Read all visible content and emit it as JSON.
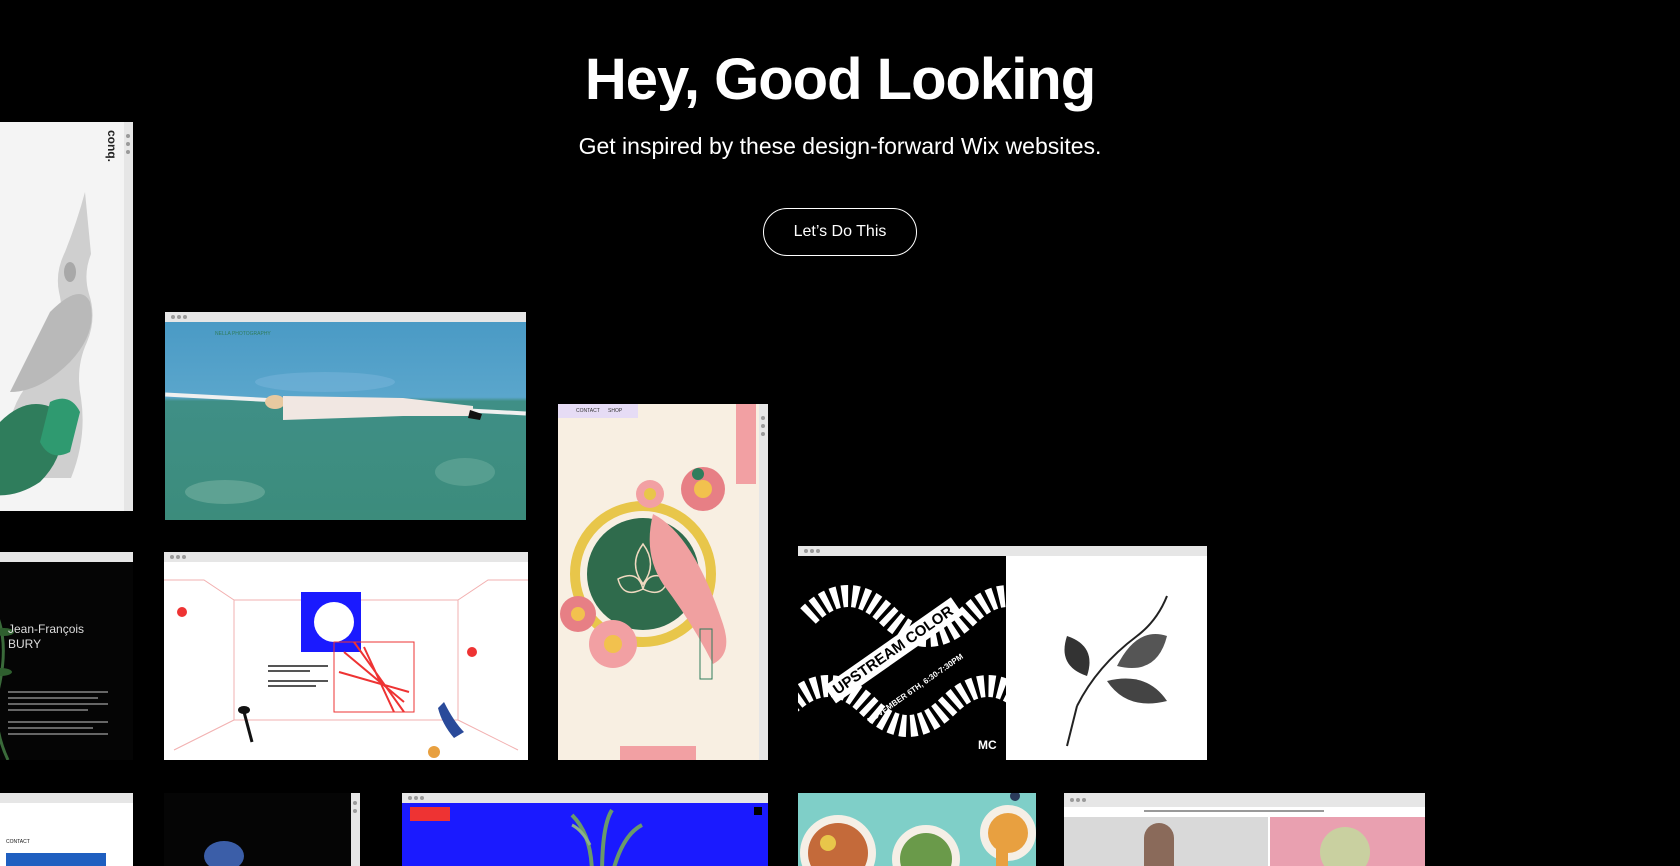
{
  "hero": {
    "title": "Hey, Good Looking",
    "subtitle": "Get inspired by these design-forward Wix websites.",
    "cta_label": "Let’s Do This"
  },
  "cards": {
    "conq": {
      "logo": "conq."
    },
    "photo": {
      "brand": "NELLA PHOTOGRAPHY"
    },
    "jean": {
      "name_line1": "Jean-François",
      "name_line2": "BURY"
    },
    "poster": {
      "headline": "UPSTREAM COLOR",
      "date_line": "NOVEMBER 6TH, 6:30-7:30PM",
      "mc": "MC"
    },
    "pink": {
      "tab1": "CONTACT",
      "tab2": "SHOP"
    },
    "bottom_left": {
      "menu_item": "CONTACT"
    }
  },
  "colors": {
    "background": "#000000",
    "accent_green": "#2f7d5c",
    "accent_pink": "#f2a0a3",
    "court_blue": "#4a9ac5",
    "poster_blue": "#1a1aff"
  }
}
